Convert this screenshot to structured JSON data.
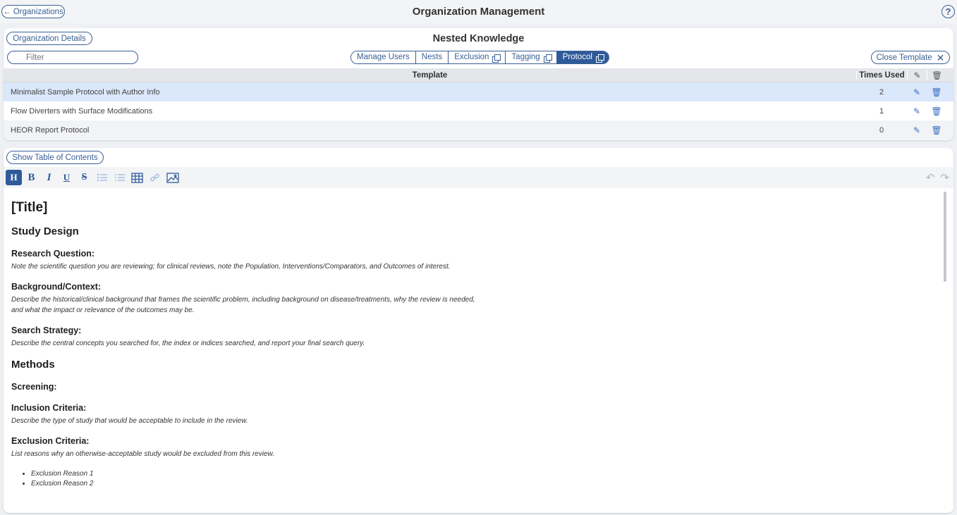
{
  "topbar": {
    "back_label": "← Organizations",
    "title": "Organization Management",
    "help": "?"
  },
  "panel": {
    "org_details_label": "Organization Details",
    "org_name": "Nested Knowledge",
    "filter_placeholder": "Filter",
    "close_template_label": "Close Template",
    "tabs": [
      {
        "label": "Manage Users",
        "copy": false,
        "active": false
      },
      {
        "label": "Nests",
        "copy": false,
        "active": false
      },
      {
        "label": "Exclusion",
        "copy": true,
        "active": false
      },
      {
        "label": "Tagging",
        "copy": true,
        "active": false
      },
      {
        "label": "Protocol",
        "copy": true,
        "active": true
      }
    ]
  },
  "table": {
    "headers": {
      "template": "Template",
      "times_used": "Times Used"
    },
    "rows": [
      {
        "name": "Minimalist Sample Protocol with Author Info",
        "used": "2",
        "selected": true
      },
      {
        "name": "Flow Diverters with Surface Modifications",
        "used": "1",
        "selected": false
      },
      {
        "name": "HEOR Report Protocol",
        "used": "0",
        "selected": false
      }
    ]
  },
  "editor": {
    "toc_label": "Show Table of Contents",
    "toolbar": {
      "heading": "H",
      "bold": "B",
      "italic": "I",
      "underline": "U",
      "strike": "S"
    },
    "doc": {
      "title": "[Title]",
      "study_design": "Study Design",
      "rq_heading": "Research Question:",
      "rq_text": "Note the scientific question you are reviewing; for clinical reviews, note the Population, Interventions/Comparators, and Outcomes of interest.",
      "bg_heading": "Background/Context:",
      "bg_text_1": "Describe the historical/clinical background that frames the scientific problem, including background on disease/treatments, why the review is needed,",
      "bg_text_2": "and what the impact or relevance of the outcomes may be.",
      "ss_heading": "Search Strategy:",
      "ss_text": "Describe the central concepts you searched for, the index or indices searched, and report your final search query.",
      "methods": "Methods",
      "screening": "Screening:",
      "inc_heading": "Inclusion Criteria:",
      "inc_text": "Describe the type of study that would be acceptable to include in the review.",
      "exc_heading": "Exclusion Criteria:",
      "exc_text": "List reasons why an otherwise-acceptable study would be excluded from this review.",
      "exc_reasons": [
        "Exclusion Reason 1",
        "Exclusion Reason 2"
      ]
    }
  },
  "colors": {
    "accent": "#2f5a9a",
    "selected_row": "#dbe7fa",
    "background": "#eef0f3"
  }
}
